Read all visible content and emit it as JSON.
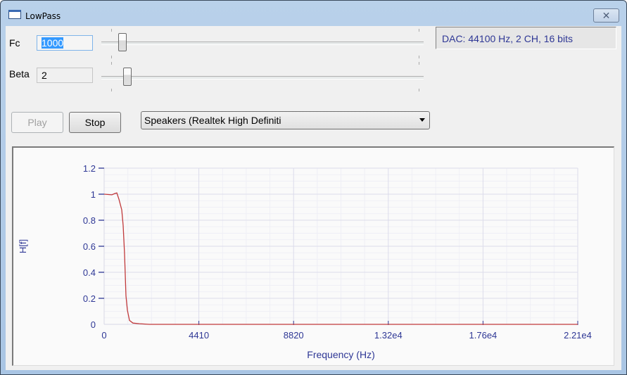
{
  "window": {
    "title": "LowPass",
    "close_glyph": "✕"
  },
  "controls": {
    "fc": {
      "label": "Fc",
      "value": "1000",
      "slider_fraction": 0.06
    },
    "beta": {
      "label": "Beta",
      "value": "2",
      "slider_fraction": 0.08
    },
    "dac_status": "DAC: 44100 Hz, 2 CH, 16 bits",
    "play_label": "Play",
    "stop_label": "Stop",
    "device_selected": "Speakers (Realtek High Definiti"
  },
  "colors": {
    "curve": "#c0393b",
    "axis_text": "#2e3795",
    "grid": "#dcdceb"
  },
  "chart_data": {
    "type": "line",
    "title": "",
    "xlabel": "Frequency (Hz)",
    "ylabel": "H[f]",
    "xlim": [
      0,
      22050
    ],
    "ylim": [
      0,
      1.2
    ],
    "xticks": [
      0,
      4410,
      8820,
      13230,
      17640,
      22050
    ],
    "xtick_labels": [
      "0",
      "4410",
      "8820",
      "1.32e4",
      "1.76e4",
      "2.21e4"
    ],
    "yticks": [
      0,
      0.2,
      0.4,
      0.6,
      0.8,
      1,
      1.2
    ],
    "ytick_labels": [
      "0",
      "0.2",
      "0.4",
      "0.6",
      "0.8",
      "1",
      "1.2"
    ],
    "grid": true,
    "series": [
      {
        "name": "H[f]",
        "x": [
          0,
          360,
          490,
          590,
          690,
          820,
          885,
          950,
          1015,
          1080,
          1180,
          1340,
          1640,
          2100,
          22050
        ],
        "y": [
          1.0,
          0.995,
          1.005,
          1.01,
          0.96,
          0.88,
          0.76,
          0.54,
          0.22,
          0.11,
          0.03,
          0.01,
          0.005,
          0.0,
          0.0
        ]
      }
    ]
  }
}
